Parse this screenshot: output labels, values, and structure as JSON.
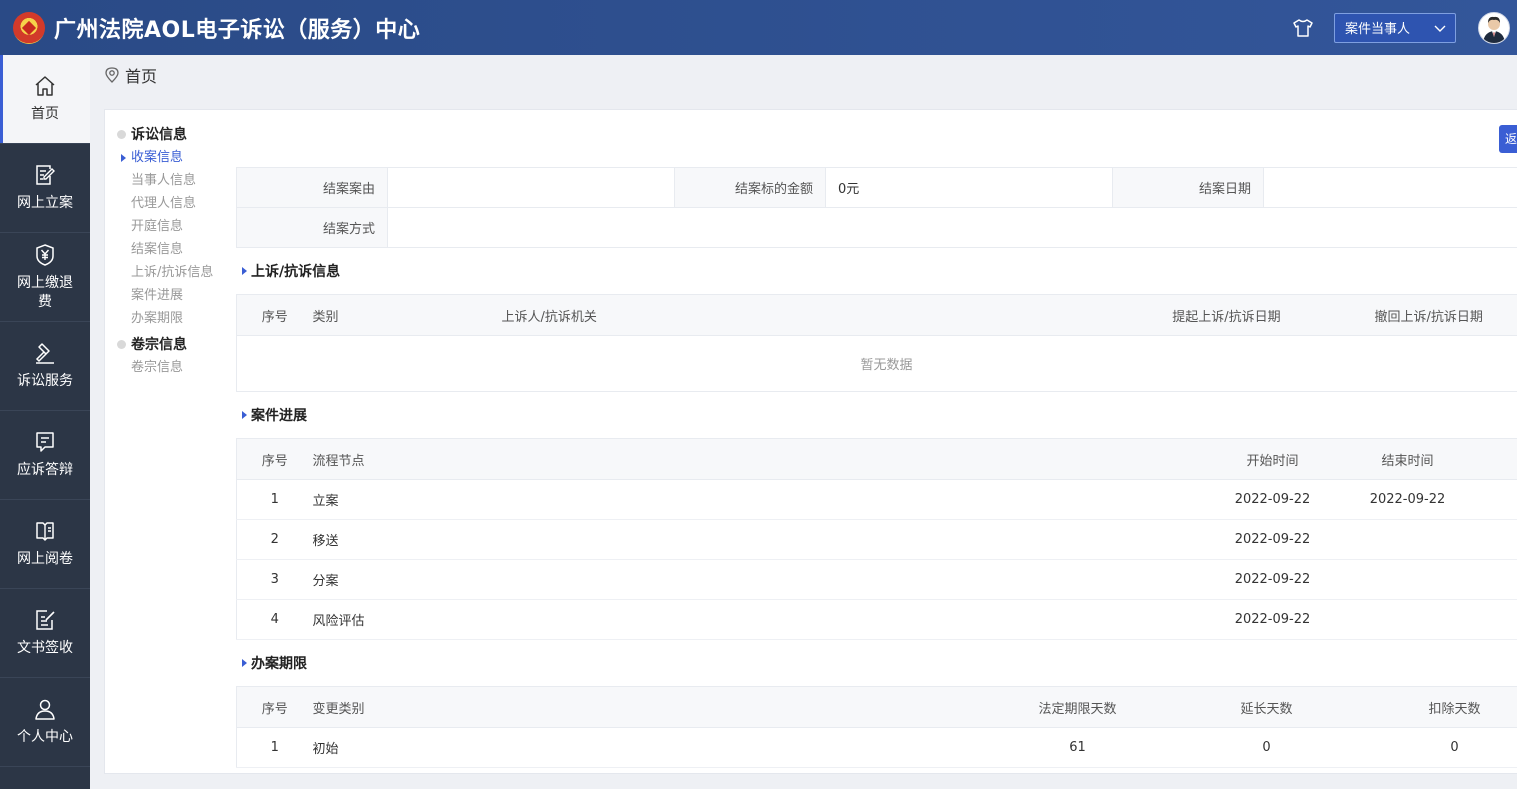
{
  "header": {
    "title": "广州法院AOL电子诉讼（服务）中心",
    "role_select": "案件当事人"
  },
  "sidebar": {
    "items": [
      {
        "label": "首页",
        "icon": "home-icon"
      },
      {
        "label": "网上立案",
        "icon": "file-edit-icon"
      },
      {
        "label": "网上缴退费",
        "icon": "yuan-shield-icon"
      },
      {
        "label": "诉讼服务",
        "icon": "gavel-icon"
      },
      {
        "label": "应诉答辩",
        "icon": "chat-doc-icon"
      },
      {
        "label": "网上阅卷",
        "icon": "book-icon"
      },
      {
        "label": "文书签收",
        "icon": "sign-doc-icon"
      },
      {
        "label": "个人中心",
        "icon": "user-icon"
      }
    ]
  },
  "breadcrumb": {
    "text": "首页"
  },
  "panel": {
    "button_label": "返"
  },
  "anchor": {
    "groups": [
      {
        "title": "诉讼信息",
        "items": [
          "收案信息",
          "当事人信息",
          "代理人信息",
          "开庭信息",
          "结案信息",
          "上诉/抗诉信息",
          "案件进展",
          "办案期限"
        ]
      },
      {
        "title": "卷宗信息",
        "items": [
          "卷宗信息"
        ]
      }
    ]
  },
  "closing": {
    "cause_label": "结案案由",
    "cause_value": "",
    "amount_label": "结案标的金额",
    "amount_value": "0元",
    "date_label": "结案日期",
    "date_value": "",
    "method_label": "结案方式",
    "method_value": ""
  },
  "appeal": {
    "title": "上诉/抗诉信息",
    "headers": [
      "序号",
      "类别",
      "上诉人/抗诉机关",
      "提起上诉/抗诉日期",
      "撤回上诉/抗诉日期"
    ],
    "empty": "暂无数据"
  },
  "progress": {
    "title": "案件进展",
    "headers": [
      "序号",
      "流程节点",
      "开始时间",
      "结束时间"
    ],
    "rows": [
      {
        "no": "1",
        "node": "立案",
        "start": "2022-09-22",
        "end": "2022-09-22"
      },
      {
        "no": "2",
        "node": "移送",
        "start": "2022-09-22",
        "end": ""
      },
      {
        "no": "3",
        "node": "分案",
        "start": "2022-09-22",
        "end": ""
      },
      {
        "no": "4",
        "node": "风险评估",
        "start": "2022-09-22",
        "end": ""
      }
    ]
  },
  "deadline": {
    "title": "办案期限",
    "headers": [
      "序号",
      "变更类别",
      "法定期限天数",
      "延长天数",
      "扣除天数"
    ],
    "rows": [
      {
        "no": "1",
        "type": "初始",
        "legal": "61",
        "ext": "0",
        "deduct": "0"
      }
    ]
  }
}
